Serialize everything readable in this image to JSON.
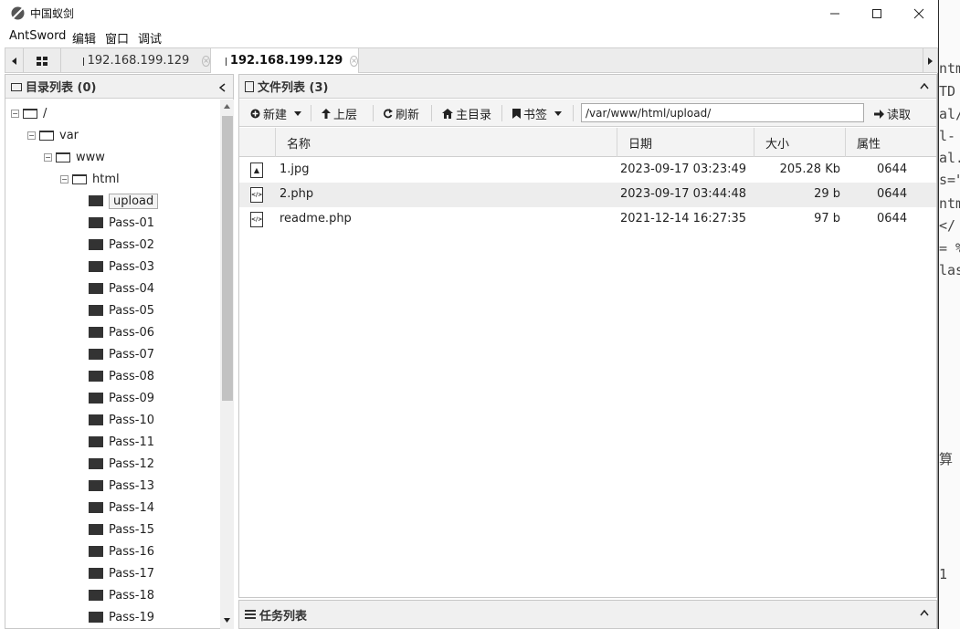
{
  "window": {
    "title": "中国蚁剑",
    "icons": {
      "app": "antsword-logo-icon",
      "minimize": "minimize-icon",
      "maximize": "maximize-icon",
      "close": "close-icon"
    }
  },
  "menu": [
    "AntSword",
    "编辑",
    "窗口",
    "调试"
  ],
  "tabs": {
    "home_icon": "grid-icon",
    "items": [
      {
        "label": "192.168.199.129",
        "active": false
      },
      {
        "label": "192.168.199.129",
        "active": true
      }
    ]
  },
  "directory_panel": {
    "title": "目录列表 (0)",
    "tree": [
      {
        "label": "/",
        "depth": 0,
        "open": true
      },
      {
        "label": "var",
        "depth": 1,
        "open": true
      },
      {
        "label": "www",
        "depth": 2,
        "open": true
      },
      {
        "label": "html",
        "depth": 3,
        "open": true
      },
      {
        "label": "upload",
        "depth": 4,
        "selected": true
      },
      {
        "label": "Pass-01",
        "depth": 4
      },
      {
        "label": "Pass-02",
        "depth": 4
      },
      {
        "label": "Pass-03",
        "depth": 4
      },
      {
        "label": "Pass-04",
        "depth": 4
      },
      {
        "label": "Pass-05",
        "depth": 4
      },
      {
        "label": "Pass-06",
        "depth": 4
      },
      {
        "label": "Pass-07",
        "depth": 4
      },
      {
        "label": "Pass-08",
        "depth": 4
      },
      {
        "label": "Pass-09",
        "depth": 4
      },
      {
        "label": "Pass-10",
        "depth": 4
      },
      {
        "label": "Pass-11",
        "depth": 4
      },
      {
        "label": "Pass-12",
        "depth": 4
      },
      {
        "label": "Pass-13",
        "depth": 4
      },
      {
        "label": "Pass-14",
        "depth": 4
      },
      {
        "label": "Pass-15",
        "depth": 4
      },
      {
        "label": "Pass-16",
        "depth": 4
      },
      {
        "label": "Pass-17",
        "depth": 4
      },
      {
        "label": "Pass-18",
        "depth": 4
      },
      {
        "label": "Pass-19",
        "depth": 4
      }
    ]
  },
  "file_panel": {
    "title": "文件列表 (3)",
    "toolbar": {
      "new": "新建",
      "up": "上层",
      "refresh": "刷新",
      "home": "主目录",
      "bookmark": "书签",
      "path": "/var/www/html/upload/",
      "read": "读取"
    },
    "columns": [
      "名称",
      "日期",
      "大小",
      "属性"
    ],
    "rows": [
      {
        "name": "1.jpg",
        "date": "2023-09-17 03:23:49",
        "size": "205.28 Kb",
        "attr": "0644",
        "icon": "image-file-icon"
      },
      {
        "name": "2.php",
        "date": "2023-09-17 03:44:48",
        "size": "29 b",
        "attr": "0644",
        "icon": "code-file-icon"
      },
      {
        "name": "readme.php",
        "date": "2021-12-14 16:27:35",
        "size": "97 b",
        "attr": "0644",
        "icon": "code-file-icon"
      }
    ]
  },
  "task_panel": {
    "title": "任务列表"
  },
  "background_code": [
    "ntm",
    "TD",
    "al/",
    "l-",
    "al.",
    "s=\"",
    "ntm",
    "</",
    "= %",
    "las",
    "算",
    "1"
  ]
}
